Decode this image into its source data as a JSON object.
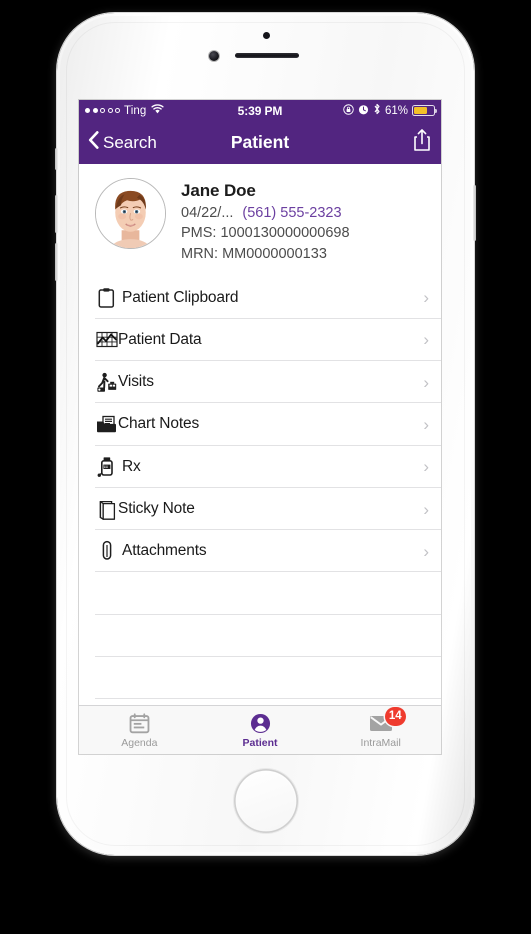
{
  "status_bar": {
    "signal_dots_filled": 2,
    "signal_dots_total": 5,
    "carrier": "Ting",
    "wifi_icon": "wifi-icon",
    "time": "5:39 PM",
    "rotation_lock_icon": "rotation-lock-icon",
    "alarm_icon": "alarm-clock-icon",
    "bluetooth_icon": "bluetooth-icon",
    "battery_percent": "61%",
    "battery_level": 61,
    "battery_color": "#f3c028"
  },
  "nav_bar": {
    "back_label": "Search",
    "back_icon": "chevron-left-icon",
    "title": "Patient",
    "share_icon": "share-icon",
    "background": "#522580"
  },
  "patient": {
    "avatar_icon": "patient-avatar",
    "name": "Jane Doe",
    "dob": "04/22/...",
    "phone": "(561) 555-2323",
    "phone_color": "#6b3fa0",
    "pms": "PMS: 1000130000000698",
    "mrn": "MRN: MM0000000133"
  },
  "list": {
    "rows": [
      {
        "label": "Patient Clipboard",
        "icon": "clipboard-icon",
        "chevron": "›"
      },
      {
        "label": "Patient Data",
        "icon": "chart-grid-icon",
        "chevron": "›"
      },
      {
        "label": "Visits",
        "icon": "visits-person-icon",
        "chevron": "›"
      },
      {
        "label": "Chart Notes",
        "icon": "folder-notes-icon",
        "chevron": "›"
      },
      {
        "label": "Rx",
        "icon": "pill-bottle-icon",
        "chevron": "›"
      },
      {
        "label": "Sticky Note",
        "icon": "sticky-note-icon",
        "chevron": "›"
      },
      {
        "label": "Attachments",
        "icon": "paperclip-icon",
        "chevron": "›"
      }
    ],
    "empty_rows": 3
  },
  "tab_bar": {
    "tabs": [
      {
        "label": "Agenda",
        "icon": "calendar-icon",
        "active": false,
        "badge": ""
      },
      {
        "label": "Patient",
        "icon": "person-circle-icon",
        "active": true,
        "badge": ""
      },
      {
        "label": "IntraMail",
        "icon": "envelope-icon",
        "active": false,
        "badge": "14"
      }
    ],
    "active_color": "#5c2d91",
    "badge_color": "#ef3b2e"
  }
}
